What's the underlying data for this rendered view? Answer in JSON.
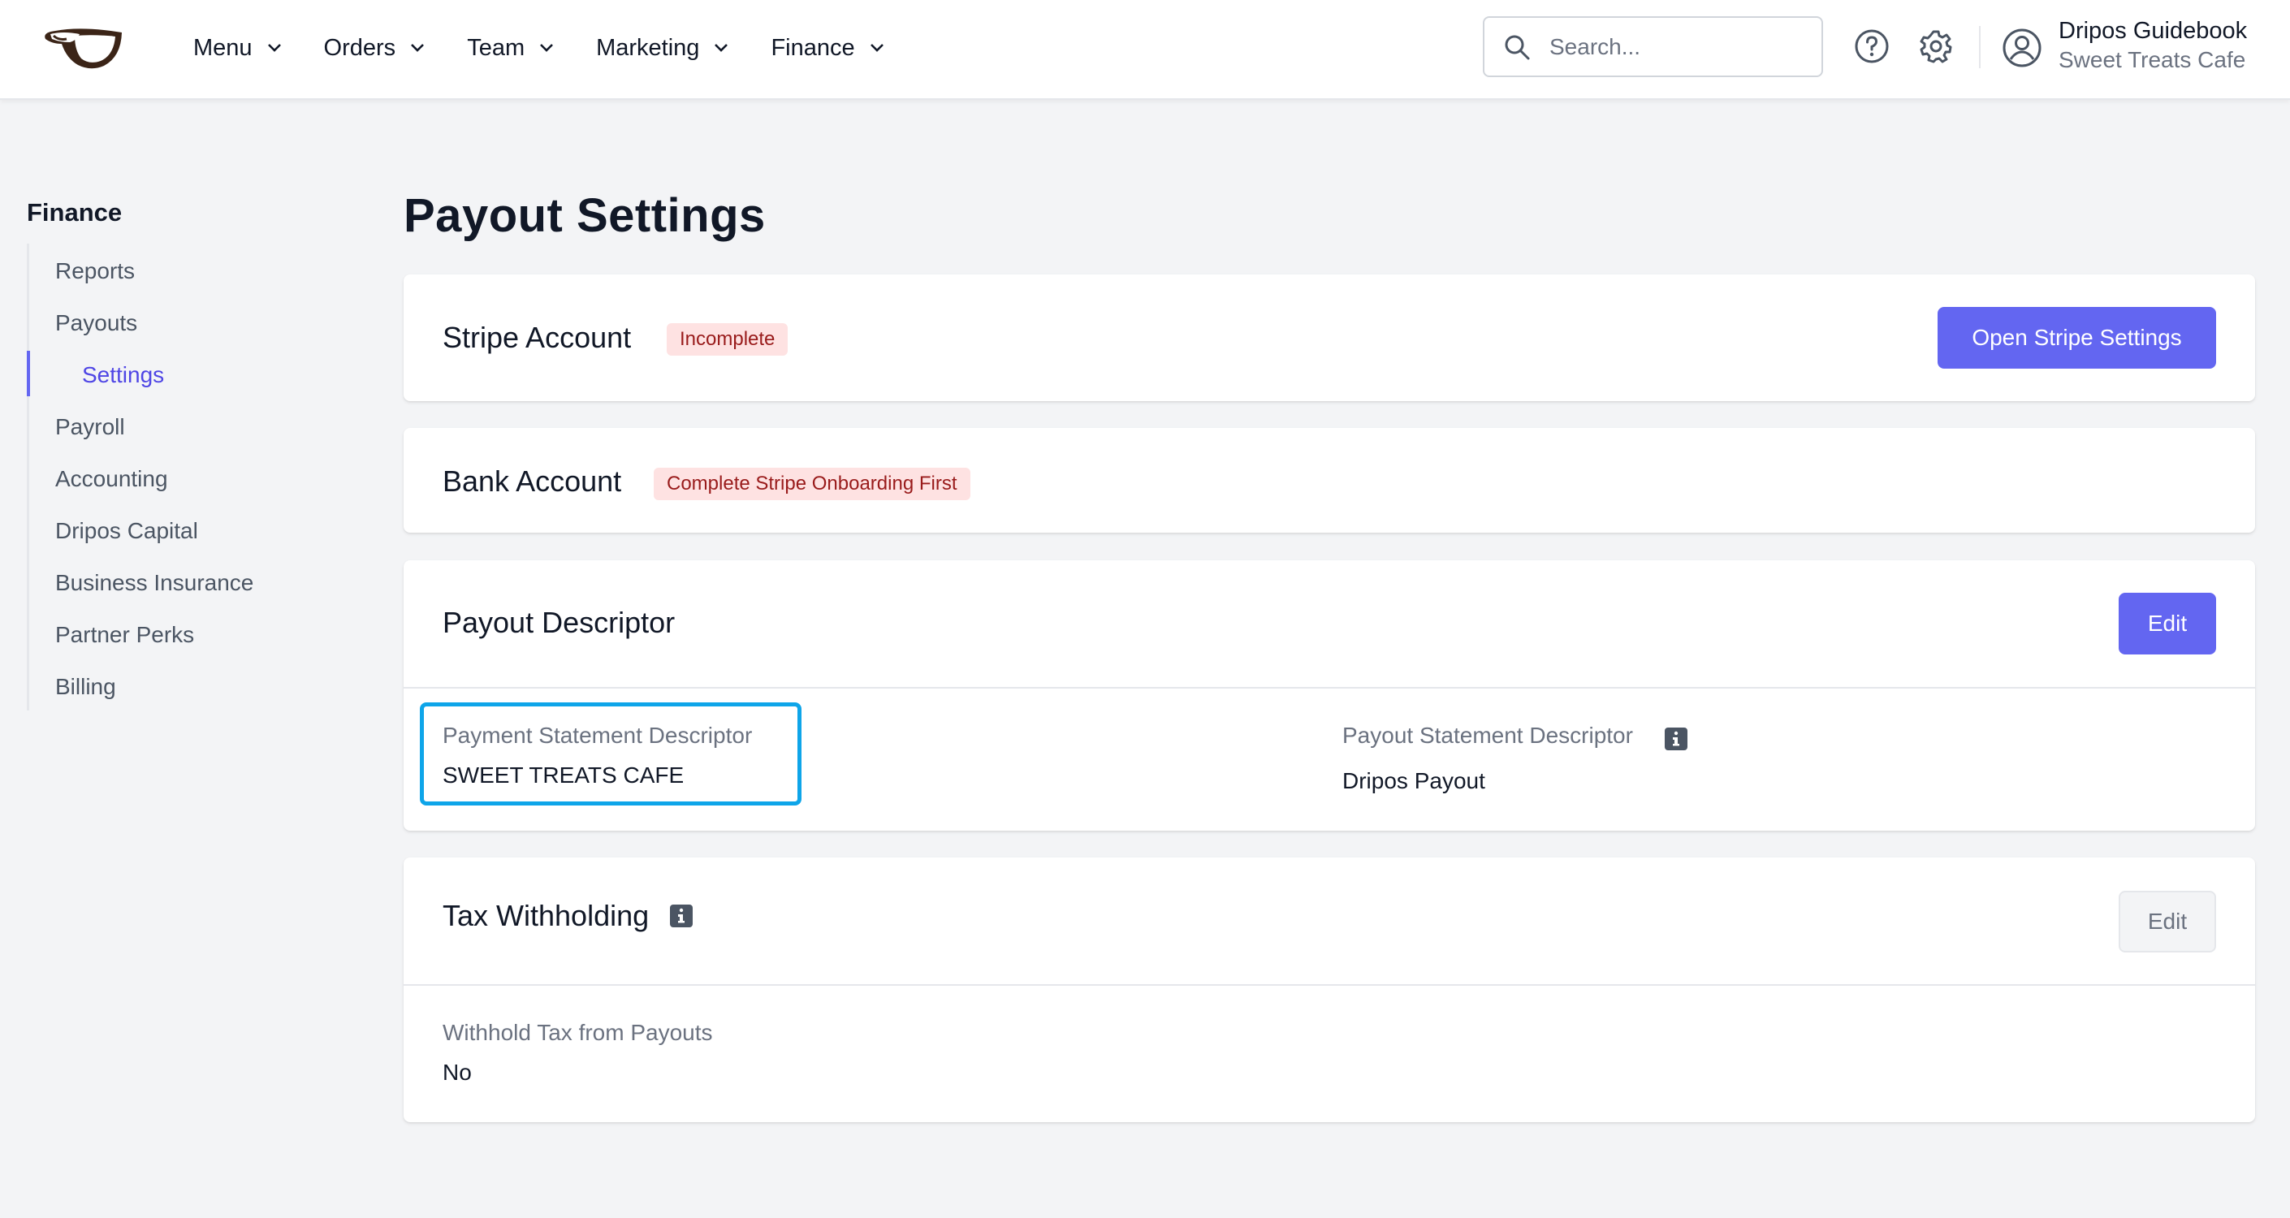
{
  "header": {
    "nav": [
      {
        "label": "Menu"
      },
      {
        "label": "Orders"
      },
      {
        "label": "Team"
      },
      {
        "label": "Marketing"
      },
      {
        "label": "Finance"
      }
    ],
    "search_placeholder": "Search...",
    "user_name": "Dripos Guidebook",
    "user_business": "Sweet Treats Cafe"
  },
  "sidebar": {
    "title": "Finance",
    "items": [
      {
        "label": "Reports"
      },
      {
        "label": "Payouts"
      },
      {
        "label": "Settings",
        "active": true
      },
      {
        "label": "Payroll"
      },
      {
        "label": "Accounting"
      },
      {
        "label": "Dripos Capital"
      },
      {
        "label": "Business Insurance"
      },
      {
        "label": "Partner Perks"
      },
      {
        "label": "Billing"
      }
    ]
  },
  "page": {
    "title": "Payout Settings",
    "stripe": {
      "title": "Stripe Account",
      "status": "Incomplete",
      "button": "Open Stripe Settings"
    },
    "bank": {
      "title": "Bank Account",
      "status": "Complete Stripe Onboarding First"
    },
    "descriptor": {
      "title": "Payout Descriptor",
      "edit": "Edit",
      "payment_label": "Payment Statement Descriptor",
      "payment_value": "SWEET TREATS CAFE",
      "payout_label": "Payout Statement Descriptor",
      "payout_value": "Dripos Payout"
    },
    "tax": {
      "title": "Tax Withholding",
      "edit": "Edit",
      "label": "Withhold Tax from Payouts",
      "value": "No"
    }
  },
  "colors": {
    "accent": "#6366f1",
    "badge_bg": "#fee2e2",
    "badge_text": "#991b1b",
    "highlight": "#0ea5e9"
  }
}
